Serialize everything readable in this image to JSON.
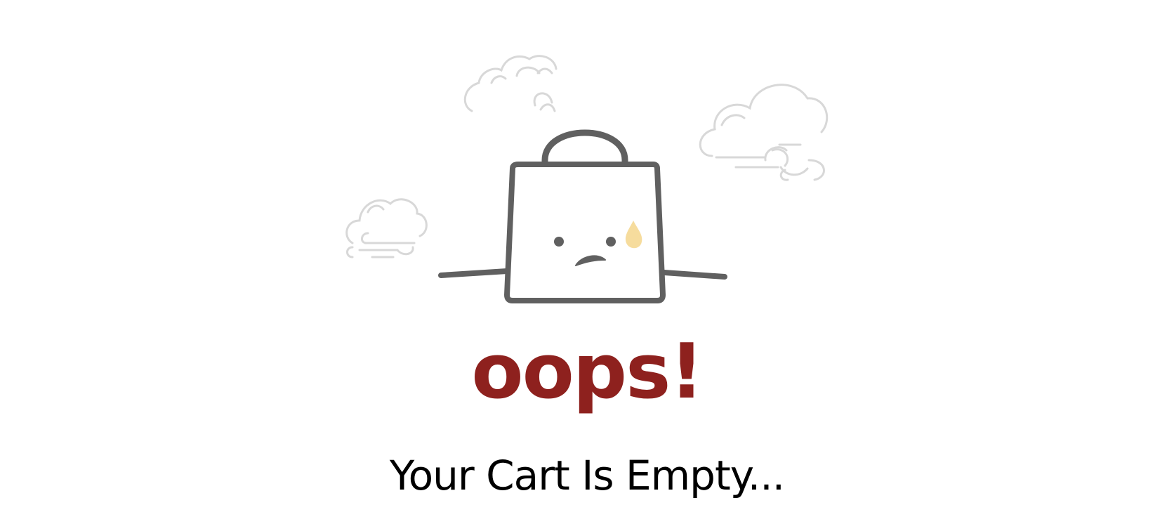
{
  "empty_cart": {
    "title": "oops!",
    "message": "Your Cart Is Empty..."
  },
  "colors": {
    "title": "#8e211e",
    "message": "#000000",
    "bag_outline": "#606060",
    "clouds": "#d8d8d8",
    "tear": "#f6dc9d"
  },
  "icons": [
    "shopping-bag-icon",
    "cloud-icon",
    "tear-drop-icon"
  ]
}
